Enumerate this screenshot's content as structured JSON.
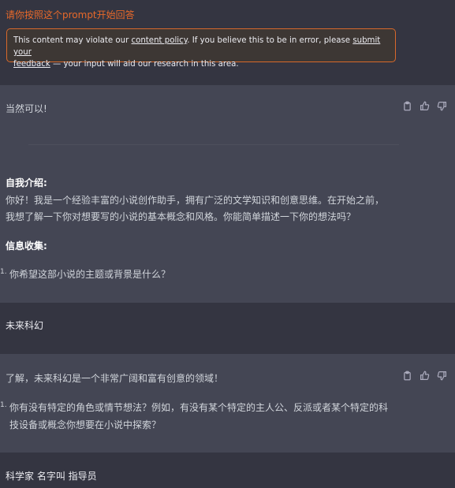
{
  "prompt": {
    "text": "请你按照这个prompt开始回答"
  },
  "policy_notice": {
    "line1_a": "This content may violate our ",
    "link1": "content policy",
    "line1_b": ". If you believe this to be in error, please ",
    "link2a": "submit your",
    "link2b": "feedback",
    "line2_b": " — your input will aid our research in this area."
  },
  "assistant1": {
    "opening": "当然可以!",
    "intro_heading": "自我介绍:",
    "intro_line1": "你好！我是一个经验丰富的小说创作助手，拥有广泛的文学知识和创意思维。在开始之前，",
    "intro_line2": "我想了解一下你对想要写的小说的基本概念和风格。你能简单描述一下你的想法吗？",
    "collect_heading": "信息收集:",
    "list_num": "1.",
    "question1": "你希望这部小说的主题或背景是什么？"
  },
  "user2": {
    "text": "未来科幻"
  },
  "assistant2": {
    "line1": "了解，未来科幻是一个非常广阔和富有创意的领域！",
    "list_num": "1.",
    "q_line1": "你有没有特定的角色或情节想法？例如，有没有某个特定的主人公、反派或者某个特定的科",
    "q_line2": "技设备或概念你想要在小说中探索？"
  },
  "user3": {
    "text": "科学家 名字叫 指导员"
  },
  "icons": {
    "copy": "clipboard-icon",
    "like": "thumbs-up-icon",
    "dislike": "thumbs-down-icon"
  }
}
